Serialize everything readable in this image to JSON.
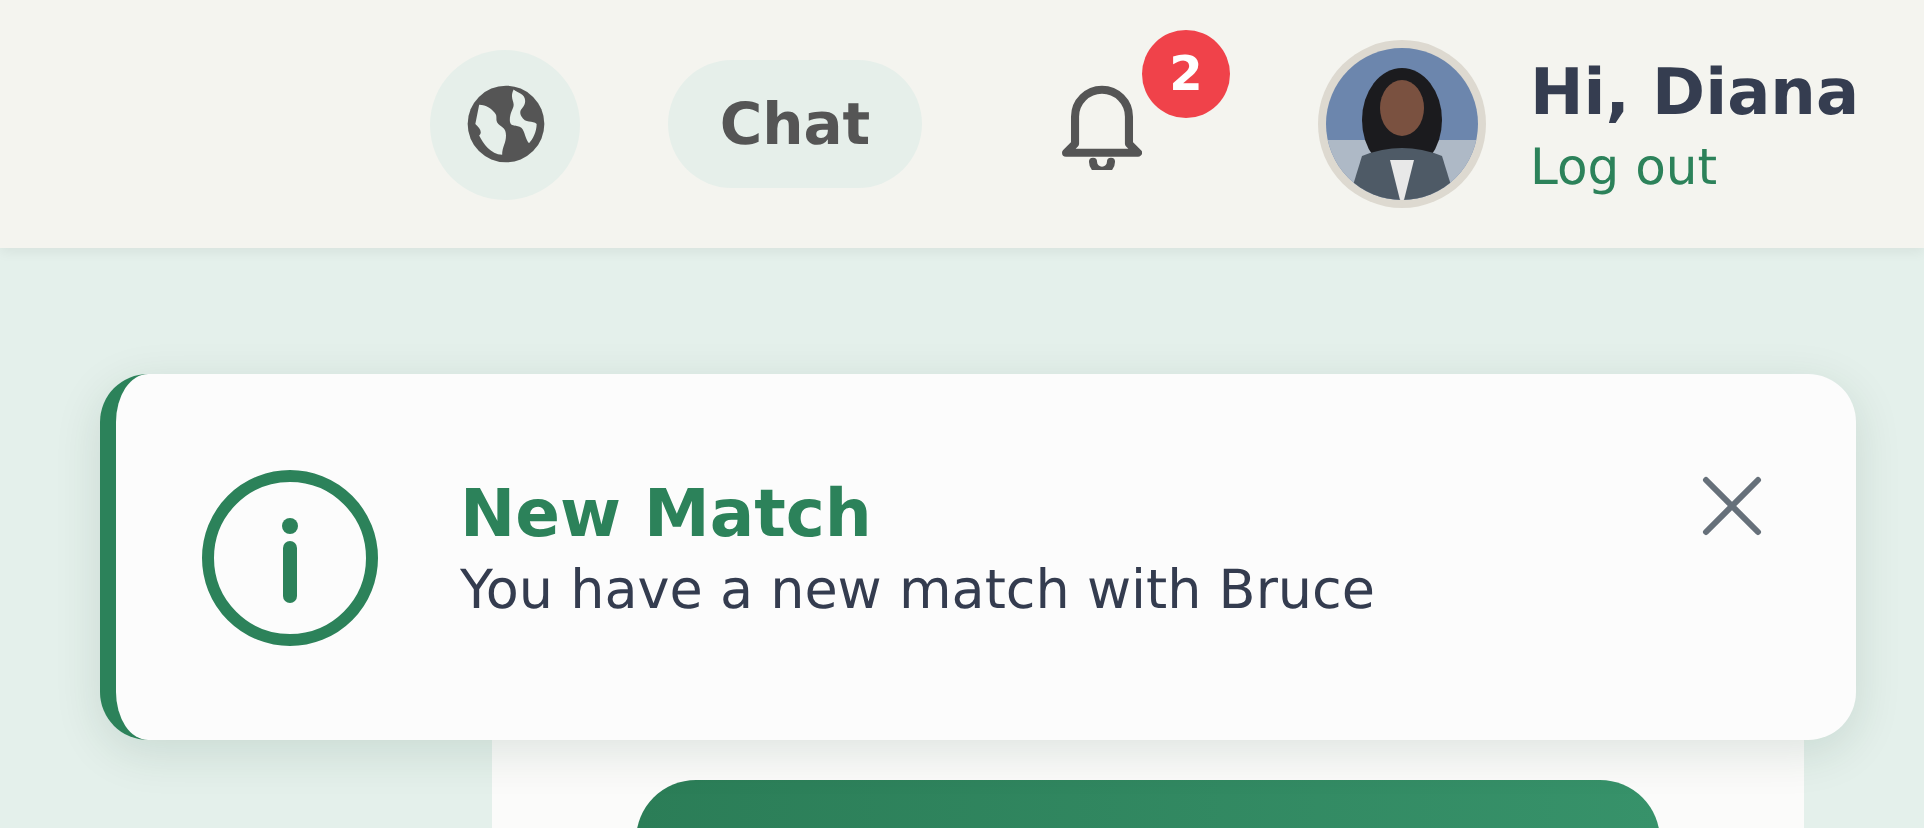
{
  "header": {
    "chat_button": "Chat",
    "notifications": {
      "count": "2"
    },
    "user": {
      "greeting": "Hi, Diana",
      "logout": "Log out"
    }
  },
  "toast": {
    "title": "New Match",
    "message": "You have a new match with Bruce"
  }
}
